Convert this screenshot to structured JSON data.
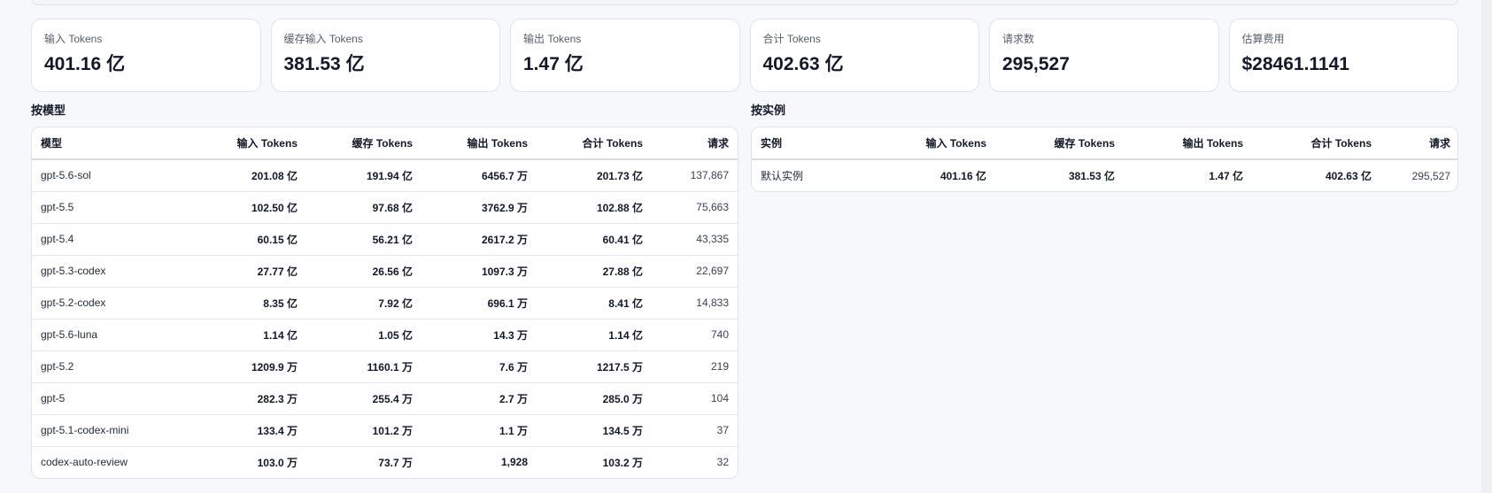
{
  "stats": [
    {
      "label": "输入 Tokens",
      "value": "401.16 亿"
    },
    {
      "label": "缓存输入 Tokens",
      "value": "381.53 亿"
    },
    {
      "label": "输出 Tokens",
      "value": "1.47 亿"
    },
    {
      "label": "合计 Tokens",
      "value": "402.63 亿"
    },
    {
      "label": "请求数",
      "value": "295,527"
    },
    {
      "label": "估算费用",
      "value": "$28461.1141"
    }
  ],
  "by_model": {
    "title": "按模型",
    "headers": [
      "模型",
      "输入 Tokens",
      "缓存 Tokens",
      "输出 Tokens",
      "合计 Tokens",
      "请求"
    ],
    "rows": [
      [
        "gpt-5.6-sol",
        "201.08 亿",
        "191.94 亿",
        "6456.7 万",
        "201.73 亿",
        "137,867"
      ],
      [
        "gpt-5.5",
        "102.50 亿",
        "97.68 亿",
        "3762.9 万",
        "102.88 亿",
        "75,663"
      ],
      [
        "gpt-5.4",
        "60.15 亿",
        "56.21 亿",
        "2617.2 万",
        "60.41 亿",
        "43,335"
      ],
      [
        "gpt-5.3-codex",
        "27.77 亿",
        "26.56 亿",
        "1097.3 万",
        "27.88 亿",
        "22,697"
      ],
      [
        "gpt-5.2-codex",
        "8.35 亿",
        "7.92 亿",
        "696.1 万",
        "8.41 亿",
        "14,833"
      ],
      [
        "gpt-5.6-luna",
        "1.14 亿",
        "1.05 亿",
        "14.3 万",
        "1.14 亿",
        "740"
      ],
      [
        "gpt-5.2",
        "1209.9 万",
        "1160.1 万",
        "7.6 万",
        "1217.5 万",
        "219"
      ],
      [
        "gpt-5",
        "282.3 万",
        "255.4 万",
        "2.7 万",
        "285.0 万",
        "104"
      ],
      [
        "gpt-5.1-codex-mini",
        "133.4 万",
        "101.2 万",
        "1.1 万",
        "134.5 万",
        "37"
      ],
      [
        "codex-auto-review",
        "103.0 万",
        "73.7 万",
        "1,928",
        "103.2 万",
        "32"
      ]
    ]
  },
  "by_instance": {
    "title": "按实例",
    "headers": [
      "实例",
      "输入 Tokens",
      "缓存 Tokens",
      "输出 Tokens",
      "合计 Tokens",
      "请求"
    ],
    "rows": [
      [
        "默认实例",
        "401.16 亿",
        "381.53 亿",
        "1.47 亿",
        "402.63 亿",
        "295,527"
      ]
    ]
  }
}
